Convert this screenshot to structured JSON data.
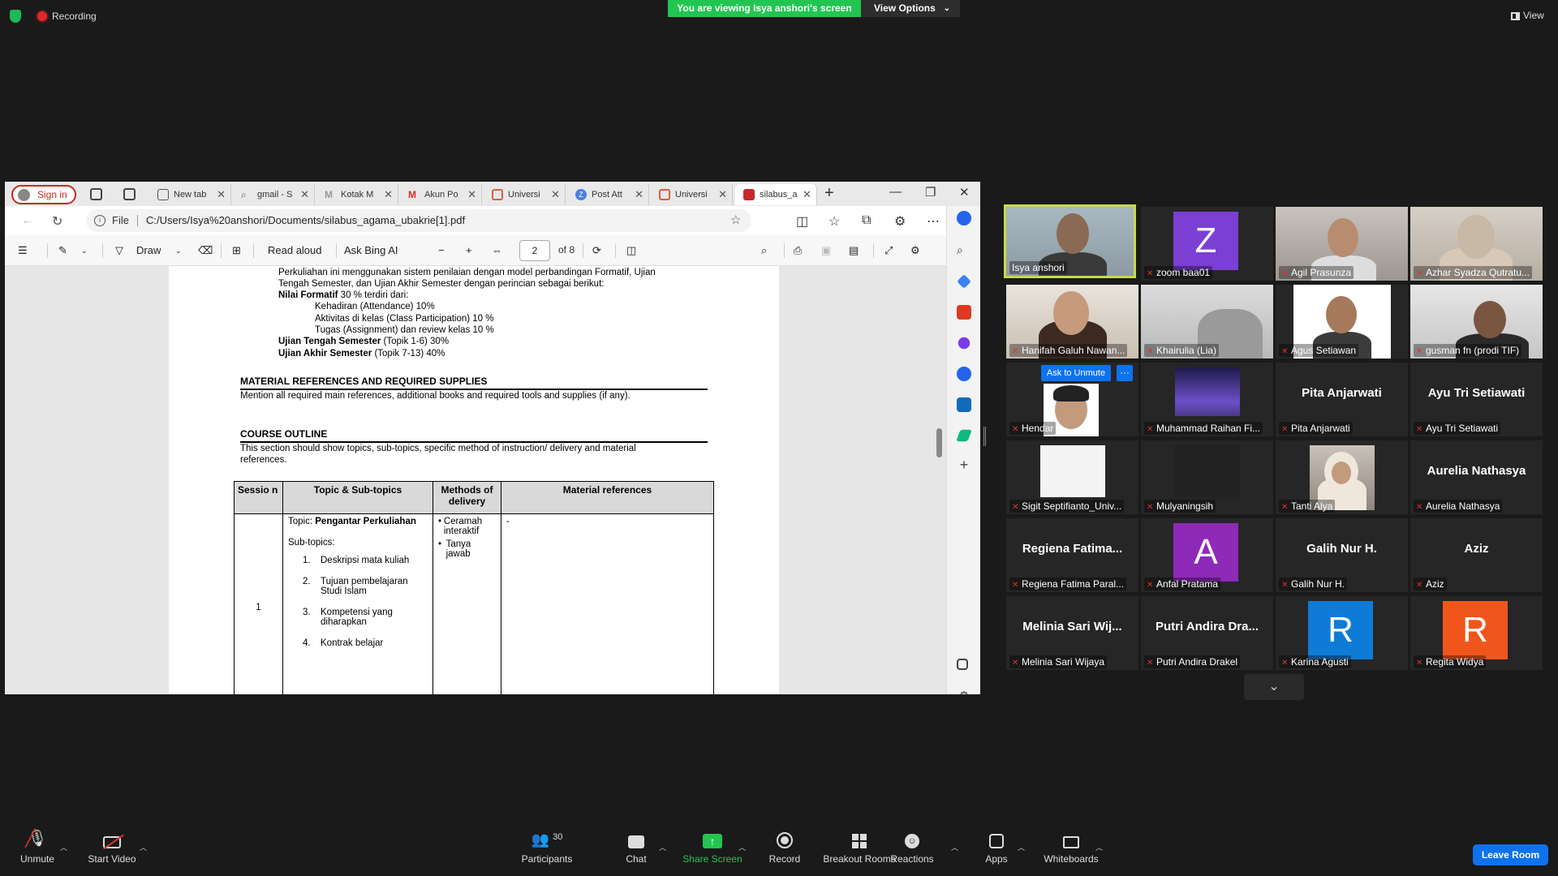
{
  "topbar": {
    "recording_label": "Recording",
    "viewing_banner": "You are viewing Isya anshori's screen",
    "view_options_label": "View Options",
    "view_label": "View"
  },
  "browser": {
    "sign_in_label": "Sign in",
    "tabs": [
      {
        "label": "New tab"
      },
      {
        "label": "gmail - S"
      },
      {
        "label": "Kotak M"
      },
      {
        "label": "Akun Po"
      },
      {
        "label": "Universi"
      },
      {
        "label": "Post Att"
      },
      {
        "label": "Universi"
      },
      {
        "label": "silabus_a"
      }
    ],
    "address": {
      "file_label": "File",
      "url": "C:/Users/Isya%20anshori/Documents/silabus_agama_ubakrie[1].pdf"
    },
    "pdf_toolbar": {
      "draw_label": "Draw",
      "read_aloud_label": "Read aloud",
      "ask_bing_label": "Ask Bing AI",
      "page_number": "2",
      "page_of": "of 8"
    }
  },
  "document": {
    "para1_line1": "Perkuliahan ini menggunakan sistem penilaian dengan model perbandingan Formatif,  Ujian",
    "para1_line2": "Tengah Semester, dan Ujian Akhir Semester dengan perincian sebagai berikut:",
    "nilai_formatif_label": "Nilai Formatif",
    "nilai_formatif_rest": " 30 % terdiri dari:",
    "kehadiran": "Kehadiran  (Attendance)  10%",
    "aktivitas": "Aktivitas di kelas (Class Participation) 10 %",
    "tugas": "Tugas  (Assignment) dan review kelas 10 %",
    "uts_label": "Ujian Tengah Semester",
    "uts_rest": " (Topik 1-6) 30%",
    "uas_label": "Ujian Akhir Semester",
    "uas_rest": " (Topik 7-13) 40%",
    "material_heading": "MATERIAL REFERENCES AND REQUIRED SUPPLIES",
    "material_text": "Mention all required main references, additional books and required tools and supplies (if any).",
    "outline_heading": "COURSE OUTLINE",
    "outline_text_line1": "This  section  should  show  topics,  sub-topics,  specific  method  of  instruction/  delivery  and  material",
    "outline_text_line2": "references.",
    "table": {
      "headers": [
        "Sessio n",
        "Topic & Sub-topics",
        "Methods of delivery",
        "Material references"
      ],
      "row": {
        "session": "1",
        "topic_prefix": "Topic: ",
        "topic_title": "Pengantar Perkuliahan",
        "subtopics_label": "Sub-topics:",
        "subtopics": [
          {
            "n": "1.",
            "text": "Deskripsi mata kuliah"
          },
          {
            "n": "2.",
            "text": "Tujuan pembelajaran Studi Islam"
          },
          {
            "n": "3.",
            "text": "Kompetensi yang diharapkan"
          },
          {
            "n": "4.",
            "text": "Kontrak belajar"
          }
        ],
        "methods": [
          "Ceramah interaktif",
          "Tanya jawab"
        ],
        "references": "-"
      }
    }
  },
  "gallery": {
    "ask_to_unmute": "Ask to Unmute",
    "more_label": "···",
    "participants": [
      {
        "name": "Isya anshori"
      },
      {
        "name": "zoom baa01",
        "letter": "Z"
      },
      {
        "name": "Agil Prasunza"
      },
      {
        "name": "Azhar Syadza Qutratu..."
      },
      {
        "name": "Hanifah Galuh Nawan..."
      },
      {
        "name": "Khairulia (Lia)"
      },
      {
        "name": "Agus Setiawan"
      },
      {
        "name": "gusman fn (prodi TIF)"
      },
      {
        "name": "Hendar"
      },
      {
        "name": "Muhammad Raihan Fi..."
      },
      {
        "name": "Pita Anjarwati",
        "big": "Pita Anjarwati"
      },
      {
        "name": "Ayu Tri Setiawati",
        "big": "Ayu Tri Setiawati"
      },
      {
        "name": "Sigit Septifianto_Univ..."
      },
      {
        "name": "Mulyaningsih"
      },
      {
        "name": "Tanti Alya"
      },
      {
        "name": "Aurelia Nathasya",
        "big": "Aurelia Nathasya"
      },
      {
        "name": "Regiena Fatima Paral...",
        "big": "Regiena Fatima..."
      },
      {
        "name": "Anfal Pratama",
        "letter": "A"
      },
      {
        "name": "Galih Nur H.",
        "big": "Galih Nur H."
      },
      {
        "name": "Aziz",
        "big": "Aziz"
      },
      {
        "name": "Melinia Sari Wijaya",
        "big": "Melinia Sari Wij..."
      },
      {
        "name": "Putri Andira Drakel",
        "big": "Putri Andira Dra..."
      },
      {
        "name": "Karina Agusti",
        "letter": "R"
      },
      {
        "name": "Regita Widya",
        "letter": "R"
      }
    ]
  },
  "toolbar": {
    "unmute": "Unmute",
    "start_video": "Start Video",
    "participants": "Participants",
    "participants_count": "30",
    "chat": "Chat",
    "share_screen": "Share Screen",
    "record": "Record",
    "breakout_rooms": "Breakout Rooms",
    "reactions": "Reactions",
    "apps": "Apps",
    "whiteboards": "Whiteboards",
    "leave_room": "Leave Room"
  },
  "colors": {
    "banner_green": "#23c551",
    "zoom_blue": "#0e72ed",
    "active_speaker": "#c6d94e",
    "muted_red": "#e0312f"
  }
}
